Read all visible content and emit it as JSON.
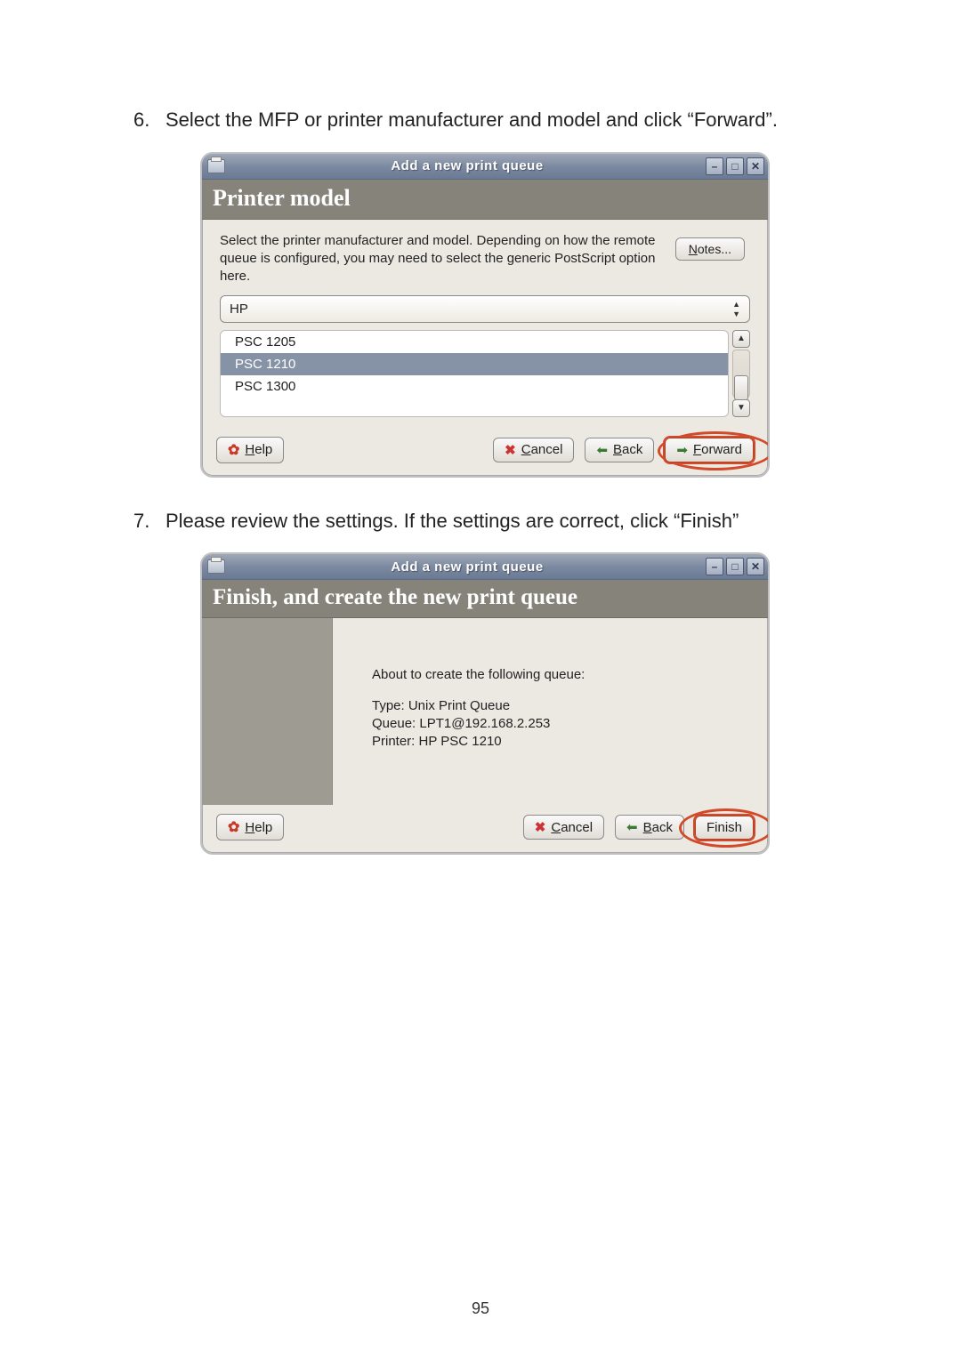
{
  "step6": {
    "number": "6.",
    "text": "Select the MFP or printer manufacturer and model and click “Forward”."
  },
  "step7": {
    "number": "7.",
    "text": "Please review the settings. If the settings are correct, click “Finish”"
  },
  "dialog1": {
    "titlebar": "Add a new print queue",
    "heading": "Printer model",
    "description": "Select the printer manufacturer and model. Depending on how the remote queue is configured, you may need to select the generic PostScript option here.",
    "notes_pre": "N",
    "notes_rest": "otes...",
    "manufacturer": "HP",
    "models": [
      "PSC 1205",
      "PSC 1210",
      "PSC 1300"
    ],
    "selected_index": 1,
    "buttons": {
      "help_pre": "H",
      "help_rest": "elp",
      "cancel_pre": "C",
      "cancel_rest": "ancel",
      "back_pre": "B",
      "back_rest": "ack",
      "forward_pre": "F",
      "forward_rest": "orward"
    }
  },
  "dialog2": {
    "titlebar": "Add a new print queue",
    "heading": "Finish, and create the new print queue",
    "about": "About to create the following queue:",
    "line_type": "Type: Unix Print Queue",
    "line_queue": "Queue: LPT1@192.168.2.253",
    "line_printer": "Printer: HP PSC 1210",
    "buttons": {
      "help_pre": "H",
      "help_rest": "elp",
      "cancel_pre": "C",
      "cancel_rest": "ancel",
      "back_pre": "B",
      "back_rest": "ack",
      "finish": "Finish"
    }
  },
  "page_number": "95"
}
